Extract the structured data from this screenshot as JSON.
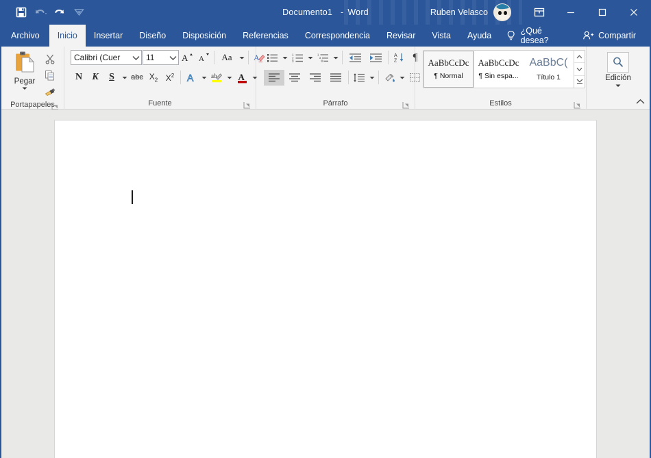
{
  "titlebar": {
    "quick_access": [
      {
        "name": "save-button",
        "icon": "save-icon",
        "label": "Guardar"
      },
      {
        "name": "undo-button",
        "icon": "undo-icon",
        "label": "Deshacer"
      },
      {
        "name": "redo-button",
        "icon": "redo-icon",
        "label": "Rehacer"
      },
      {
        "name": "customize-qat-button",
        "icon": "chevron-down-icon",
        "label": "Personalizar barra de herramientas de acceso rápido"
      }
    ],
    "document_name": "Documento1",
    "separator": "-",
    "app_name": "Word",
    "user_name": "Ruben Velasco",
    "avatar_label": "Foto de perfil",
    "ribbon_display_label": "Opciones de presentación de la cinta de opciones",
    "minimize_label": "Minimizar",
    "maximize_label": "Maximizar",
    "close_label": "Cerrar",
    "accent_color": "#2b579a"
  },
  "tabs": [
    {
      "label": "Archivo",
      "active": false
    },
    {
      "label": "Inicio",
      "active": true
    },
    {
      "label": "Insertar",
      "active": false
    },
    {
      "label": "Diseño",
      "active": false
    },
    {
      "label": "Disposición",
      "active": false
    },
    {
      "label": "Referencias",
      "active": false
    },
    {
      "label": "Correspondencia",
      "active": false
    },
    {
      "label": "Revisar",
      "active": false
    },
    {
      "label": "Vista",
      "active": false
    },
    {
      "label": "Ayuda",
      "active": false
    }
  ],
  "tell_me": {
    "label": "¿Qué desea?",
    "icon": "lightbulb-icon"
  },
  "share": {
    "label": "Compartir",
    "icon": "person-add-icon"
  },
  "ribbon": {
    "clipboard": {
      "label": "Portapapeles",
      "paste_label": "Pegar",
      "cut_label": "Cortar",
      "copy_label": "Copiar",
      "format_painter_label": "Copiar formato"
    },
    "font": {
      "label": "Fuente",
      "font_name": "Calibri (Cuer",
      "font_size": "11",
      "grow_font_label": "Aumentar tamaño de fuente",
      "shrink_font_label": "Disminuir tamaño de fuente",
      "change_case_label": "Aa",
      "clear_format_label": "Borrar todo el formato",
      "bold_label": "N",
      "italic_label": "K",
      "underline_label": "S",
      "strike_label": "abc",
      "subscript_label": "X",
      "superscript_label": "X",
      "text_effects_label": "A",
      "highlight_label": "Color de resaltado del texto",
      "font_color_label": "A",
      "highlight_color": "#ffff00",
      "font_color_value": "#c00000"
    },
    "paragraph": {
      "label": "Párrafo",
      "bullets_label": "Viñetas",
      "numbering_label": "Numeración",
      "multilevel_label": "Lista multinivel",
      "decrease_indent_label": "Disminuir sangría",
      "increase_indent_label": "Aumentar sangría",
      "sort_label": "Ordenar",
      "marks_label": "¶",
      "align_left_label": "Alinear a la izquierda",
      "align_center_label": "Centrar",
      "align_right_label": "Alinear a la derecha",
      "justify_label": "Justificar",
      "line_spacing_label": "Espaciado entre líneas y párrafos",
      "shading_label": "Sombreado",
      "borders_label": "Bordes"
    },
    "styles": {
      "label": "Estilos",
      "items": [
        {
          "preview": "AaBbCcDc",
          "name": "¶ Normal",
          "selected": true,
          "heading": false
        },
        {
          "preview": "AaBbCcDc",
          "name": "¶ Sin espa...",
          "selected": false,
          "heading": false
        },
        {
          "preview": "AaBbC(",
          "name": "Título 1",
          "selected": false,
          "heading": true
        }
      ],
      "scroll_up_label": "Fila anterior",
      "scroll_down_label": "Fila siguiente",
      "more_label": "Más estilos"
    },
    "editing": {
      "label": "Edición",
      "icon": "search-icon"
    },
    "collapse_label": "Contraer la cinta de opciones"
  },
  "document": {
    "page_label": "Página del documento",
    "caret_label": "Cursor de texto",
    "content": ""
  }
}
